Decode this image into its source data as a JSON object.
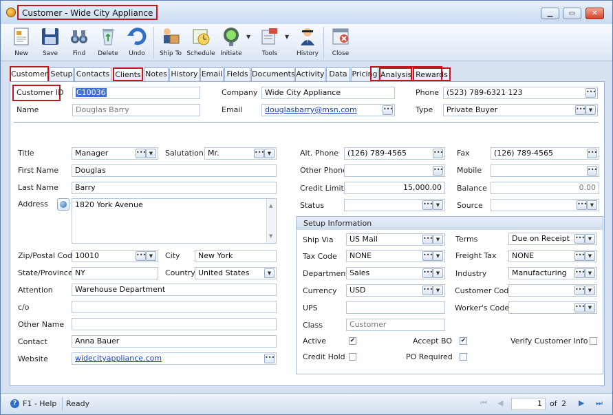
{
  "window": {
    "title": "Customer - Wide City Appliance",
    "minimize": "▁",
    "maximize": "▭",
    "close": "✕"
  },
  "toolbar": [
    {
      "label": "New",
      "icon": "new-document-icon"
    },
    {
      "label": "Save",
      "icon": "save-disk-icon"
    },
    {
      "label": "Find",
      "icon": "binoculars-icon"
    },
    {
      "label": "Delete",
      "icon": "recycle-bin-icon"
    },
    {
      "label": "Undo",
      "icon": "undo-arrow-icon"
    },
    {
      "label": "Ship To",
      "icon": "ship-to-icon"
    },
    {
      "label": "Schedule",
      "icon": "schedule-icon"
    },
    {
      "label": "Initiate",
      "icon": "traffic-light-icon"
    },
    {
      "label": "Tools",
      "icon": "tools-icon"
    },
    {
      "label": "History",
      "icon": "history-person-icon"
    },
    {
      "label": "Close",
      "icon": "close-document-icon"
    }
  ],
  "tabs": [
    "Customer",
    "Setup",
    "Contacts",
    "Clients",
    "Notes",
    "History",
    "Email",
    "Fields",
    "Documents",
    "Activity",
    "Data",
    "Pricing",
    "Analysis",
    "Rewards"
  ],
  "header": {
    "customer_id_label": "Customer ID",
    "customer_id": "C10036",
    "name_label": "Name",
    "name": "Douglas  Barry",
    "company_label": "Company",
    "company": "Wide City Appliance",
    "email_label": "Email",
    "email": "douglasbarry@msn.com",
    "phone_label": "Phone",
    "phone": "(523) 789-6321 123",
    "type_label": "Type",
    "type": "Private Buyer"
  },
  "left": {
    "title_label": "Title",
    "title": "Manager",
    "salutation_label": "Salutation",
    "salutation": "Mr.",
    "first_name_label": "First Name",
    "first_name": "Douglas",
    "last_name_label": "Last Name",
    "last_name": "Barry",
    "address_label": "Address",
    "address": "1820 York Avenue",
    "zip_label": "Zip/Postal Code",
    "zip": "10010",
    "city_label": "City",
    "city": "New York",
    "state_label": "State/Province",
    "state": "NY",
    "country_label": "Country",
    "country": "United States",
    "attention_label": "Attention",
    "attention": "Warehouse Department",
    "co_label": "c/o",
    "co": "",
    "other_name_label": "Other Name",
    "other_name": "",
    "contact_label": "Contact",
    "contact": "Anna Bauer",
    "website_label": "Website",
    "website": "widecityappliance.com"
  },
  "right": {
    "alt_phone_label": "Alt. Phone",
    "alt_phone": "(126) 789-4565",
    "fax_label": "Fax",
    "fax": "(126) 789-4565",
    "other_phone_label": "Other Phone",
    "other_phone": "",
    "mobile_label": "Mobile",
    "mobile": "",
    "credit_limit_label": "Credit Limit",
    "credit_limit": "15,000.00",
    "balance_label": "Balance",
    "balance": "0.00",
    "status_label": "Status",
    "status": "",
    "source_label": "Source",
    "source": ""
  },
  "setup": {
    "header": "Setup Information",
    "ship_via_label": "Ship Via",
    "ship_via": "US Mail",
    "terms_label": "Terms",
    "terms": "Due on Receipt",
    "tax_code_label": "Tax Code",
    "tax_code": "NONE",
    "freight_tax_label": "Freight Tax",
    "freight_tax": "NONE",
    "department_label": "Department",
    "department": "Sales",
    "industry_label": "Industry",
    "industry": "Manufacturing",
    "currency_label": "Currency",
    "currency": "USD",
    "customer_code_label": "Customer Code",
    "customer_code": "",
    "ups_label": "UPS",
    "ups": "",
    "workers_code_label": "Worker's Code",
    "workers_code": "",
    "class_label": "Class",
    "class": "Customer",
    "active_label": "Active",
    "active_checked": true,
    "accept_bo_label": "Accept BO",
    "accept_bo_checked": true,
    "verify_label": "Verify Customer Info",
    "verify_checked": false,
    "credit_hold_label": "Credit Hold",
    "credit_hold_checked": false,
    "po_required_label": "PO Required",
    "po_required_checked": false
  },
  "status": {
    "help": "F1 - Help",
    "ready": "Ready",
    "page": "1",
    "of_label": "of",
    "total": "2"
  },
  "colors": {
    "highlight": "#c0171c",
    "link": "#1a3fb0",
    "selection": "#3d6fd1"
  }
}
